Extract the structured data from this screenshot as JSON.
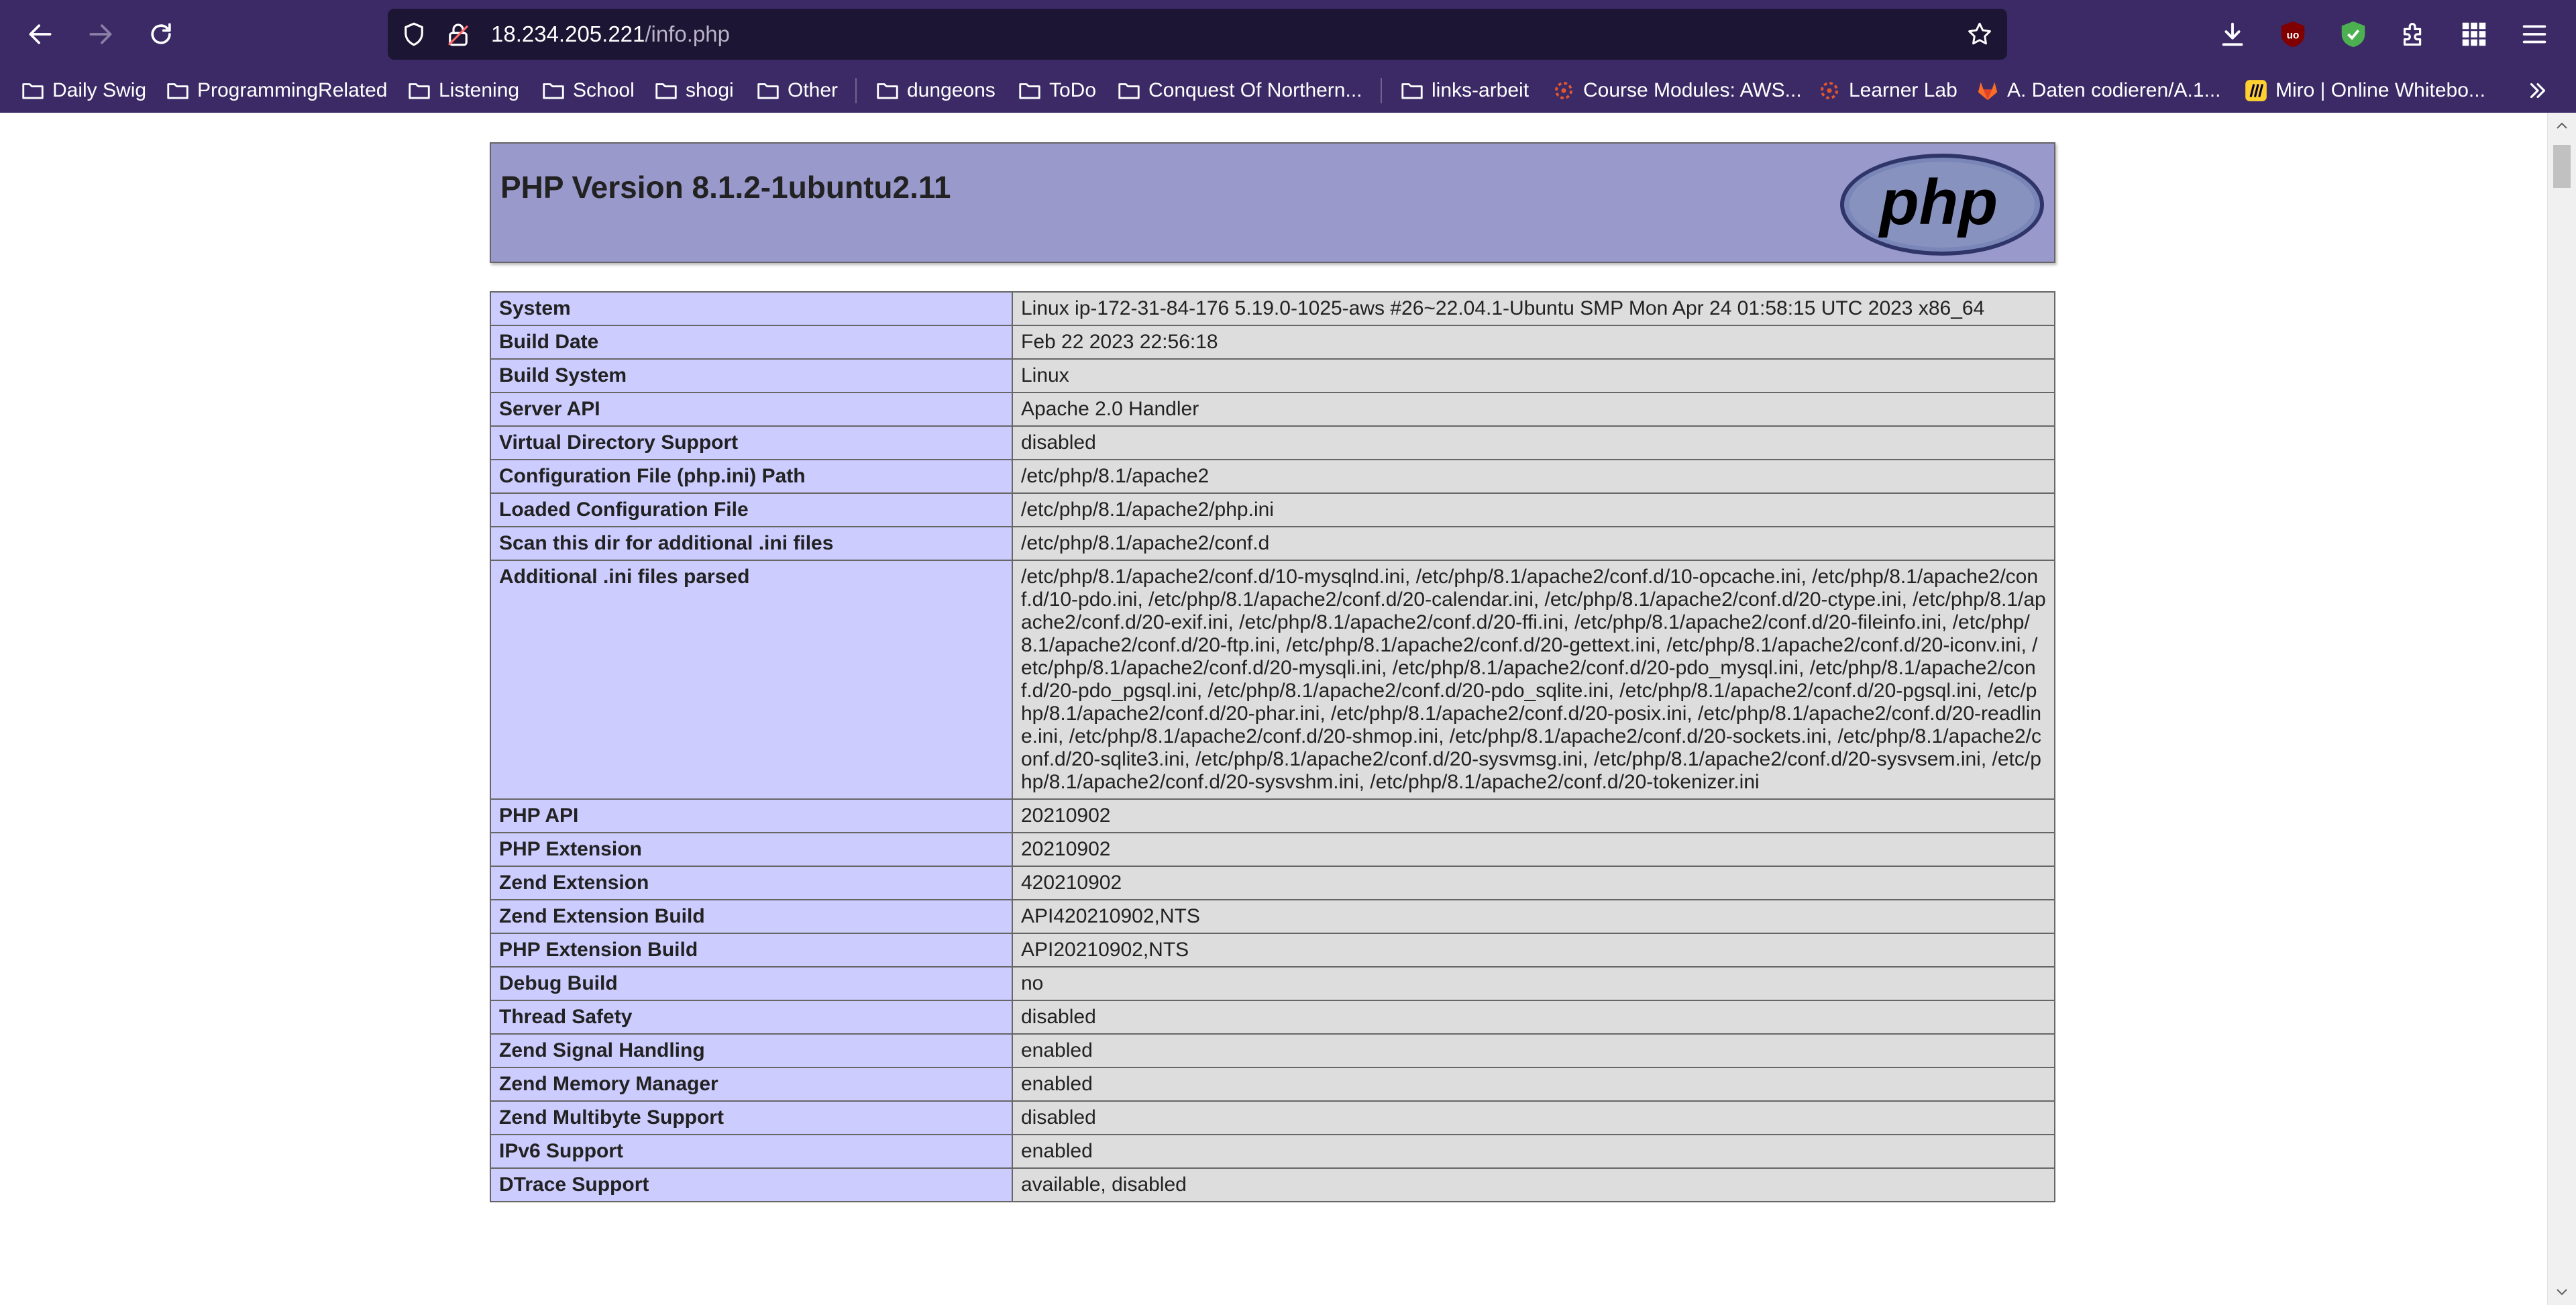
{
  "browser": {
    "url_host": "18.234.205.221",
    "url_path": "/info.php",
    "bookmarks": [
      {
        "label": "Daily Swig",
        "icon": "folder-icon"
      },
      {
        "label": "ProgrammingRelated",
        "icon": "folder-icon"
      },
      {
        "label": "Listening",
        "icon": "folder-icon"
      },
      {
        "label": "School",
        "icon": "folder-icon"
      },
      {
        "label": "shogi",
        "icon": "folder-icon"
      },
      {
        "label": "Other",
        "icon": "folder-icon"
      },
      {
        "label": "dungeons",
        "icon": "folder-icon"
      },
      {
        "label": "ToDo",
        "icon": "folder-icon"
      },
      {
        "label": "Conquest Of Northern...",
        "icon": "folder-icon"
      },
      {
        "label": "links-arbeit",
        "icon": "folder-icon"
      },
      {
        "label": "Course Modules: AWS...",
        "icon": "canvas-icon"
      },
      {
        "label": "Learner Lab",
        "icon": "canvas-icon"
      },
      {
        "label": "A. Daten codieren/A.1...",
        "icon": "gitlab-icon"
      },
      {
        "label": "Miro | Online Whitebo...",
        "icon": "miro-icon"
      }
    ],
    "colors": {
      "chrome": "#3b2a66",
      "urlbar": "#1c1533"
    }
  },
  "page": {
    "title": "PHP Version 8.1.2-1ubuntu2.11",
    "logo_text": "php",
    "colors": {
      "header": "#9999cc",
      "label_cell": "#ccccff",
      "value_cell": "#dddddd"
    },
    "rows": [
      {
        "label": "System",
        "value": "Linux ip-172-31-84-176 5.19.0-1025-aws #26~22.04.1-Ubuntu SMP Mon Apr 24 01:58:15 UTC 2023 x86_64"
      },
      {
        "label": "Build Date",
        "value": "Feb 22 2023 22:56:18"
      },
      {
        "label": "Build System",
        "value": "Linux"
      },
      {
        "label": "Server API",
        "value": "Apache 2.0 Handler"
      },
      {
        "label": "Virtual Directory Support",
        "value": "disabled"
      },
      {
        "label": "Configuration File (php.ini) Path",
        "value": "/etc/php/8.1/apache2"
      },
      {
        "label": "Loaded Configuration File",
        "value": "/etc/php/8.1/apache2/php.ini"
      },
      {
        "label": "Scan this dir for additional .ini files",
        "value": "/etc/php/8.1/apache2/conf.d"
      },
      {
        "label": "Additional .ini files parsed",
        "value": "/etc/php/8.1/apache2/conf.d/10-mysqlnd.ini, /etc/php/8.1/apache2/conf.d/10-opcache.ini, /etc/php/8.1/apache2/conf.d/10-pdo.ini, /etc/php/8.1/apache2/conf.d/20-calendar.ini, /etc/php/8.1/apache2/conf.d/20-ctype.ini, /etc/php/8.1/apache2/conf.d/20-exif.ini, /etc/php/8.1/apache2/conf.d/20-ffi.ini, /etc/php/8.1/apache2/conf.d/20-fileinfo.ini, /etc/php/8.1/apache2/conf.d/20-ftp.ini, /etc/php/8.1/apache2/conf.d/20-gettext.ini, /etc/php/8.1/apache2/conf.d/20-iconv.ini, /etc/php/8.1/apache2/conf.d/20-mysqli.ini, /etc/php/8.1/apache2/conf.d/20-pdo_mysql.ini, /etc/php/8.1/apache2/conf.d/20-pdo_pgsql.ini, /etc/php/8.1/apache2/conf.d/20-pdo_sqlite.ini, /etc/php/8.1/apache2/conf.d/20-pgsql.ini, /etc/php/8.1/apache2/conf.d/20-phar.ini, /etc/php/8.1/apache2/conf.d/20-posix.ini, /etc/php/8.1/apache2/conf.d/20-readline.ini, /etc/php/8.1/apache2/conf.d/20-shmop.ini, /etc/php/8.1/apache2/conf.d/20-sockets.ini, /etc/php/8.1/apache2/conf.d/20-sqlite3.ini, /etc/php/8.1/apache2/conf.d/20-sysvmsg.ini, /etc/php/8.1/apache2/conf.d/20-sysvsem.ini, /etc/php/8.1/apache2/conf.d/20-sysvshm.ini, /etc/php/8.1/apache2/conf.d/20-tokenizer.ini"
      },
      {
        "label": "PHP API",
        "value": "20210902"
      },
      {
        "label": "PHP Extension",
        "value": "20210902"
      },
      {
        "label": "Zend Extension",
        "value": "420210902"
      },
      {
        "label": "Zend Extension Build",
        "value": "API420210902,NTS"
      },
      {
        "label": "PHP Extension Build",
        "value": "API20210902,NTS"
      },
      {
        "label": "Debug Build",
        "value": "no"
      },
      {
        "label": "Thread Safety",
        "value": "disabled"
      },
      {
        "label": "Zend Signal Handling",
        "value": "enabled"
      },
      {
        "label": "Zend Memory Manager",
        "value": "enabled"
      },
      {
        "label": "Zend Multibyte Support",
        "value": "disabled"
      },
      {
        "label": "IPv6 Support",
        "value": "enabled"
      },
      {
        "label": "DTrace Support",
        "value": "available, disabled"
      }
    ]
  }
}
